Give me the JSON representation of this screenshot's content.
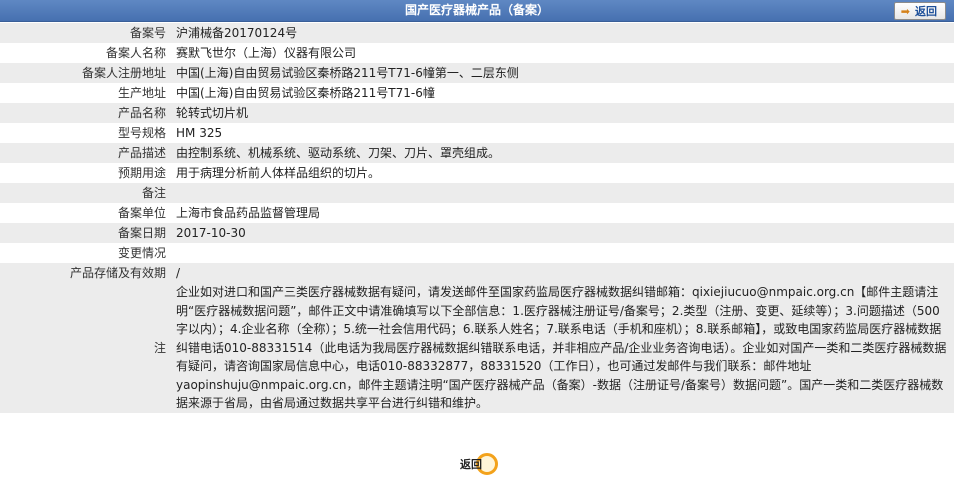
{
  "header": {
    "title": "国产医疗器械产品（备案）",
    "back_label": "返回"
  },
  "rows": [
    {
      "label": "备案号",
      "value": "沪浦械备20170124号"
    },
    {
      "label": "备案人名称",
      "value": "赛默飞世尔（上海）仪器有限公司"
    },
    {
      "label": "备案人注册地址",
      "value": "中国(上海)自由贸易试验区秦桥路211号T71-6幢第一、二层东侧"
    },
    {
      "label": "生产地址",
      "value": "中国(上海)自由贸易试验区秦桥路211号T71-6幢"
    },
    {
      "label": "产品名称",
      "value": "轮转式切片机"
    },
    {
      "label": "型号规格",
      "value": "HM 325"
    },
    {
      "label": "产品描述",
      "value": "由控制系统、机械系统、驱动系统、刀架、刀片、罩壳组成。"
    },
    {
      "label": "预期用途",
      "value": "用于病理分析前人体样品组织的切片。"
    },
    {
      "label": "备注",
      "value": ""
    },
    {
      "label": "备案单位",
      "value": "上海市食品药品监督管理局"
    },
    {
      "label": "备案日期",
      "value": "2017-10-30"
    },
    {
      "label": "变更情况",
      "value": ""
    },
    {
      "label": "产品存储及有效期",
      "value": "/"
    }
  ],
  "note": {
    "label": "注",
    "text": "企业如对进口和国产三类医疗器械数据有疑问，请发送邮件至国家药监局医疗器械数据纠错邮箱：qixiejiucuo@nmpaic.org.cn【邮件主题请注明“医疗器械数据问题”，邮件正文中请准确填写以下全部信息：1.医疗器械注册证号/备案号；2.类型（注册、变更、延续等）；3.问题描述（500字以内）；4.企业名称（全称）；5.统一社会信用代码；6.联系人姓名；7.联系电话（手机和座机）；8.联系邮箱】，或致电国家药监局医疗器械数据纠错电话010-88331514（此电话为我局医疗器械数据纠错联系电话，并非相应产品/企业业务咨询电话）。企业如对国产一类和二类医疗器械数据有疑问，请咨询国家局信息中心，电话010-88332877，88331520（工作日），也可通过发邮件与我们联系：邮件地址yaopinshuju@nmpaic.org.cn，邮件主题请注明“国产医疗器械产品（备案）-数据（注册证号/备案号）数据问题”。国产一类和二类医疗器械数据来源于省局，由省局通过数据共享平台进行纠错和维护。"
  },
  "footer": {
    "back_label": "返回"
  },
  "colors": {
    "header_bg": "#4f7abb",
    "row_alt_bg": "#ececec",
    "back_icon": "#f3a21b"
  },
  "icons": {
    "back_top": "back-arrow-icon",
    "back_bottom": "back-circle-icon"
  }
}
